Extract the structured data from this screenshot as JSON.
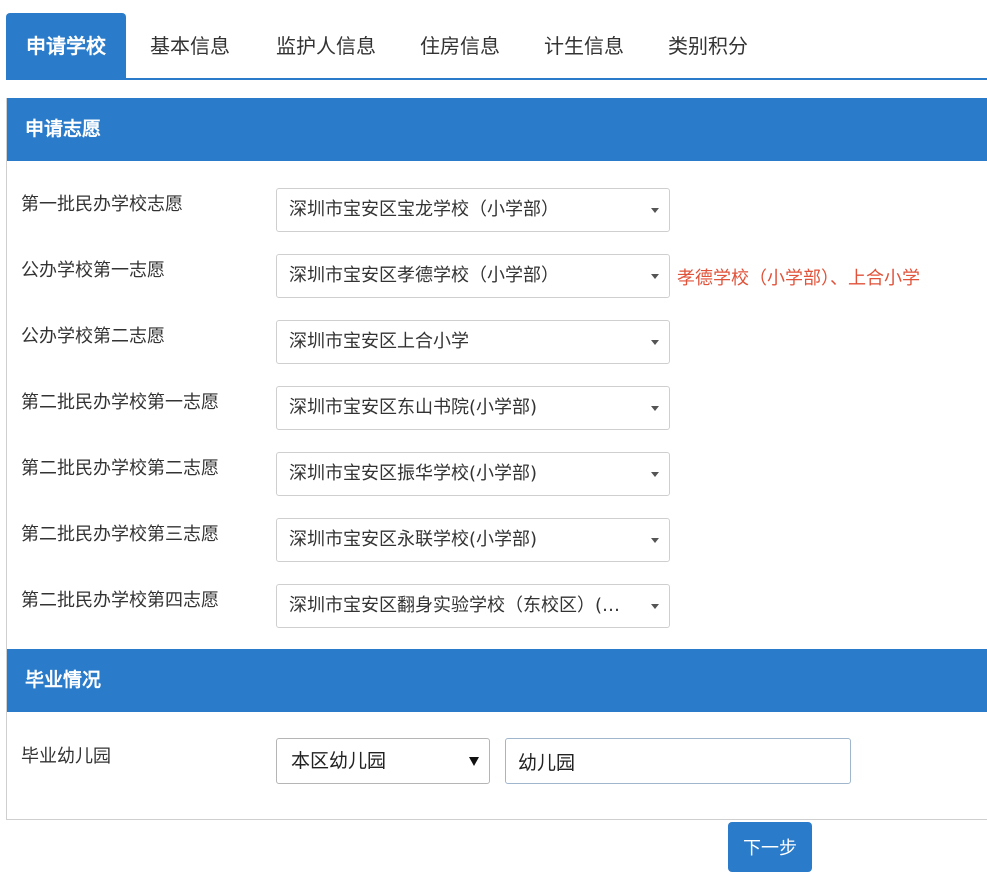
{
  "tabs": [
    {
      "label": "申请学校",
      "active": true
    },
    {
      "label": "基本信息",
      "active": false
    },
    {
      "label": "监护人信息",
      "active": false
    },
    {
      "label": "住房信息",
      "active": false
    },
    {
      "label": "计生信息",
      "active": false
    },
    {
      "label": "类别积分",
      "active": false
    }
  ],
  "sections": {
    "preferences": {
      "title": "申请志愿",
      "rows": [
        {
          "label": "第一批民办学校志愿",
          "value": "深圳市宝安区宝龙学校（小学部）"
        },
        {
          "label": "公办学校第一志愿",
          "value": "深圳市宝安区孝德学校（小学部）",
          "hint": "孝德学校（小学部）、上合小学"
        },
        {
          "label": "公办学校第二志愿",
          "value": "深圳市宝安区上合小学"
        },
        {
          "label": "第二批民办学校第一志愿",
          "value": "深圳市宝安区东山书院(小学部)"
        },
        {
          "label": "第二批民办学校第二志愿",
          "value": "深圳市宝安区振华学校(小学部)"
        },
        {
          "label": "第二批民办学校第三志愿",
          "value": "深圳市宝安区永联学校(小学部)"
        },
        {
          "label": "第二批民办学校第四志愿",
          "value": "深圳市宝安区翻身实验学校（东校区）(小..."
        }
      ]
    },
    "graduation": {
      "title": "毕业情况",
      "kindergarten_label": "毕业幼儿园",
      "kindergarten_type": "本区幼儿园",
      "kindergarten_name": "幼儿园"
    }
  },
  "actions": {
    "next_label": "下一步"
  },
  "colors": {
    "accent": "#2a7bc9",
    "hint": "#e0533a"
  }
}
